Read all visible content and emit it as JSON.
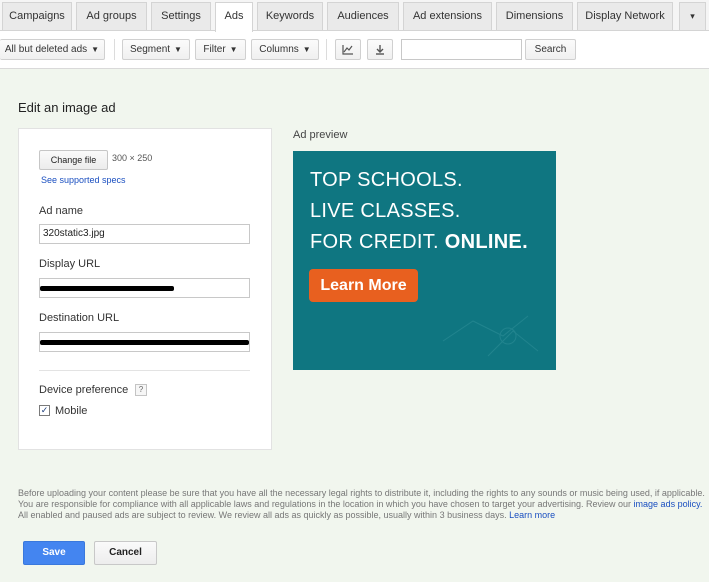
{
  "tabs": [
    {
      "label": "Campaigns"
    },
    {
      "label": "Ad groups"
    },
    {
      "label": "Settings"
    },
    {
      "label": "Ads",
      "active": true
    },
    {
      "label": "Keywords"
    },
    {
      "label": "Audiences"
    },
    {
      "label": "Ad extensions"
    },
    {
      "label": "Dimensions"
    },
    {
      "label": "Display Network"
    },
    {
      "label": "▾"
    }
  ],
  "toolbar": {
    "filter_view": "All but deleted ads",
    "segment": "Segment",
    "filter": "Filter",
    "columns": "Columns",
    "chart_icon": "line-chart-icon",
    "download_icon": "download-icon",
    "search_value": "",
    "search_button": "Search"
  },
  "page": {
    "title": "Edit an image ad"
  },
  "form": {
    "change_file": "Change file",
    "dimensions": "300 × 250",
    "specs_link": "See supported specs",
    "ad_name_label": "Ad name",
    "ad_name_value": "320static3.jpg",
    "display_url_label": "Display URL",
    "destination_url_label": "Destination URL",
    "device_pref_label": "Device preference",
    "help": "?",
    "mobile_label": "Mobile",
    "mobile_checked": true
  },
  "preview": {
    "label": "Ad preview",
    "line1": "TOP SCHOOLS.",
    "line2": "LIVE CLASSES.",
    "line3_plain": "FOR CREDIT.",
    "line3_bold": "ONLINE.",
    "cta": "Learn More",
    "bg_color": "#0f7681",
    "cta_color": "#e8601f"
  },
  "legal": {
    "text1": "Before uploading your content please be sure that you have all the necessary legal rights to distribute it, including the rights to any sounds or music being used, if applicable. You are responsible for compliance with all applicable laws and regulations in the location in which you have chosen to target your advertising. Review our",
    "policy_link": "image ads policy.",
    "text2": "All enabled and paused ads are subject to review. We review all ads as quickly as possible, usually within 3 business days.",
    "learn_more": "Learn more"
  },
  "actions": {
    "save": "Save",
    "cancel": "Cancel"
  }
}
